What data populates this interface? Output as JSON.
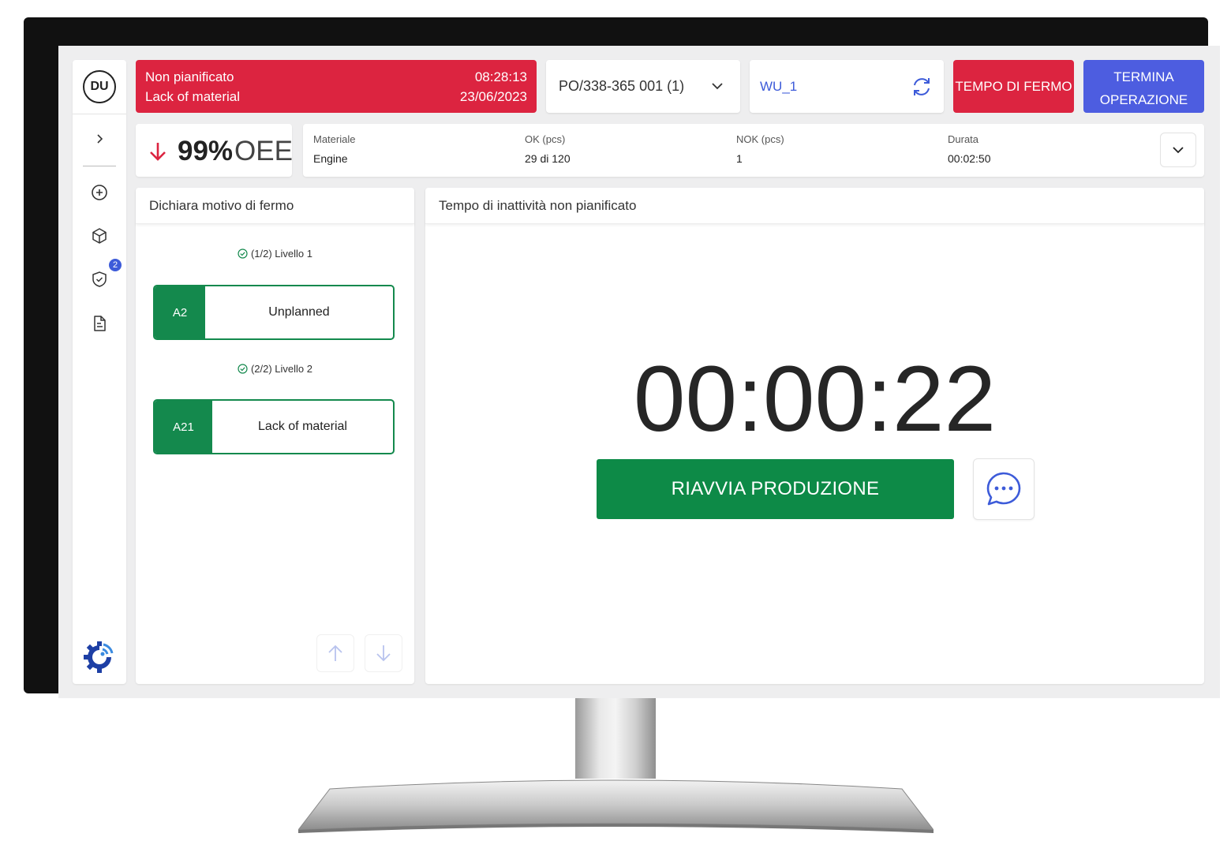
{
  "user": {
    "initials": "DU"
  },
  "sidebar": {
    "notification_count": "2"
  },
  "alarm": {
    "type": "Non pianificato",
    "reason": "Lack of material",
    "time": "08:28:13",
    "date": "23/06/2023",
    "color": "#dc2440"
  },
  "production_order": {
    "value": "PO/338-365 001 (1)"
  },
  "work_unit": {
    "value": "WU_1"
  },
  "buttons": {
    "downtime": "TEMPO DI FERMO",
    "end_operation_line1": "TERMINA",
    "end_operation_line2": "OPERAZIONE",
    "restart": "RIAVVIA PRODUZIONE"
  },
  "oee": {
    "value": "99%",
    "label": "OEE",
    "trend": "down"
  },
  "info": {
    "material_label": "Materiale",
    "material_value": "Engine",
    "ok_label": "OK (pcs)",
    "ok_value": "29 di 120",
    "nok_label": "NOK (pcs)",
    "nok_value": "1",
    "duration_label": "Durata",
    "duration_value": "00:02:50"
  },
  "left_panel": {
    "title": "Dichiara motivo di fermo",
    "levels": [
      {
        "label": "(1/2) Livello 1",
        "code": "A2",
        "name": "Unplanned"
      },
      {
        "label": "(2/2) Livello 2",
        "code": "A21",
        "name": "Lack of material"
      }
    ]
  },
  "right_panel": {
    "title": "Tempo di inattività non pianificato",
    "timer": "00:00:22"
  },
  "colors": {
    "accent_green": "#14894d",
    "restart_green": "#0d8a47",
    "alert_red": "#dc2440",
    "primary_blue": "#4d5de0"
  }
}
